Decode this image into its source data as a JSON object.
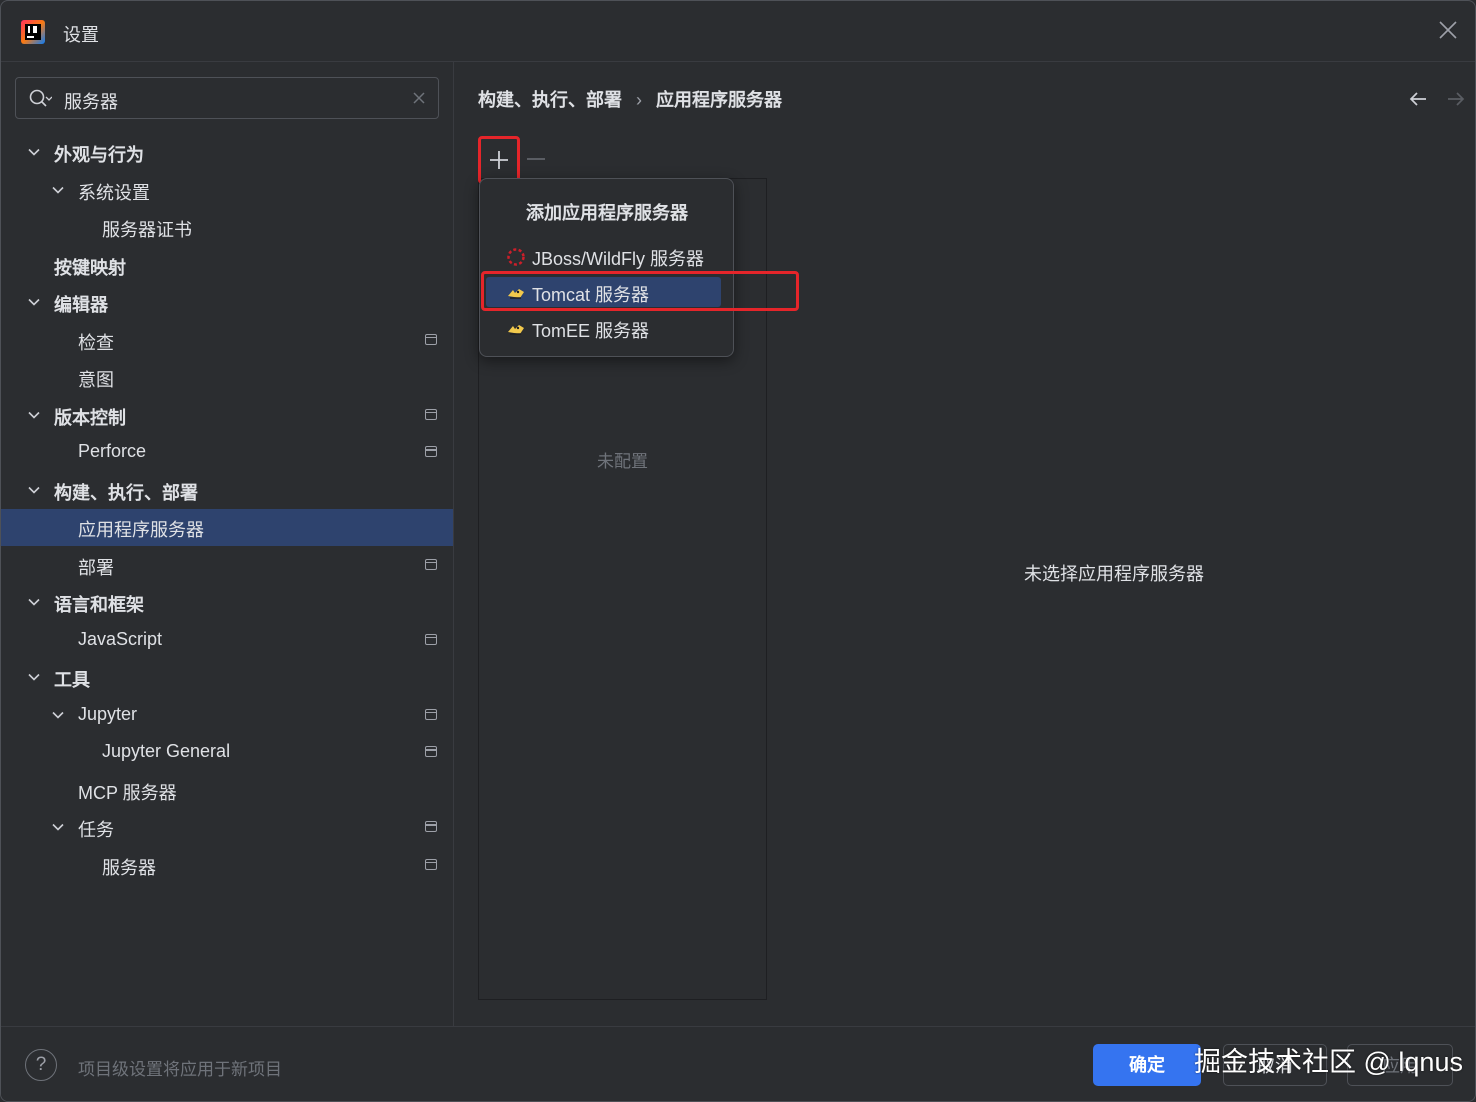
{
  "window": {
    "title": "设置"
  },
  "search": {
    "value": "服务器"
  },
  "sidebar": {
    "items": [
      {
        "label": "外观与行为",
        "level": 0,
        "expandable": true,
        "bold": true,
        "project_icon": false
      },
      {
        "label": "系统设置",
        "level": 1,
        "expandable": true,
        "bold": false,
        "project_icon": false
      },
      {
        "label": "服务器证书",
        "level": 2,
        "expandable": false,
        "bold": false,
        "project_icon": false
      },
      {
        "label": "按键映射",
        "level": 0,
        "expandable": false,
        "bold": true,
        "project_icon": false
      },
      {
        "label": "编辑器",
        "level": 0,
        "expandable": true,
        "bold": true,
        "project_icon": false
      },
      {
        "label": "检查",
        "level": 1,
        "expandable": false,
        "bold": false,
        "project_icon": true
      },
      {
        "label": "意图",
        "level": 1,
        "expandable": false,
        "bold": false,
        "project_icon": false
      },
      {
        "label": "版本控制",
        "level": 0,
        "expandable": true,
        "bold": true,
        "project_icon": true
      },
      {
        "label": "Perforce",
        "level": 1,
        "expandable": false,
        "bold": false,
        "project_icon": true
      },
      {
        "label": "构建、执行、部署",
        "level": 0,
        "expandable": true,
        "bold": true,
        "project_icon": false
      },
      {
        "label": "应用程序服务器",
        "level": 1,
        "expandable": false,
        "bold": false,
        "project_icon": false,
        "selected": true
      },
      {
        "label": "部署",
        "level": 1,
        "expandable": false,
        "bold": false,
        "project_icon": true
      },
      {
        "label": "语言和框架",
        "level": 0,
        "expandable": true,
        "bold": true,
        "project_icon": false
      },
      {
        "label": "JavaScript",
        "level": 1,
        "expandable": false,
        "bold": false,
        "project_icon": true
      },
      {
        "label": "工具",
        "level": 0,
        "expandable": true,
        "bold": true,
        "project_icon": false
      },
      {
        "label": "Jupyter",
        "level": 1,
        "expandable": true,
        "bold": false,
        "project_icon": true
      },
      {
        "label": "Jupyter General",
        "level": 2,
        "expandable": false,
        "bold": false,
        "project_icon": true
      },
      {
        "label": "MCP 服务器",
        "level": 1,
        "expandable": false,
        "bold": false,
        "project_icon": false
      },
      {
        "label": "任务",
        "level": 1,
        "expandable": true,
        "bold": false,
        "project_icon": true
      },
      {
        "label": "服务器",
        "level": 2,
        "expandable": false,
        "bold": false,
        "project_icon": true
      }
    ]
  },
  "breadcrumb": {
    "parent": "构建、执行、部署",
    "separator": "›",
    "current": "应用程序服务器"
  },
  "server_list": {
    "empty_text": "未配置"
  },
  "popup": {
    "title": "添加应用程序服务器",
    "items": [
      {
        "label": "JBoss/WildFly 服务器",
        "icon": "jboss-icon"
      },
      {
        "label": "Tomcat 服务器",
        "icon": "tomcat-icon",
        "selected": true
      },
      {
        "label": "TomEE 服务器",
        "icon": "tomee-icon"
      }
    ]
  },
  "detail": {
    "empty_text": "未选择应用程序服务器"
  },
  "footer": {
    "help_glyph": "?",
    "info_text": "项目级设置将应用于新项目",
    "ok_label": "确定",
    "cancel_label": "取消",
    "apply_label": "应用"
  },
  "watermark": "掘金技术社区 @ lqnus",
  "colors": {
    "background": "#2b2d30",
    "selection": "#2e436e",
    "accent": "#3574f0",
    "annotation_red": "#e5252a"
  }
}
